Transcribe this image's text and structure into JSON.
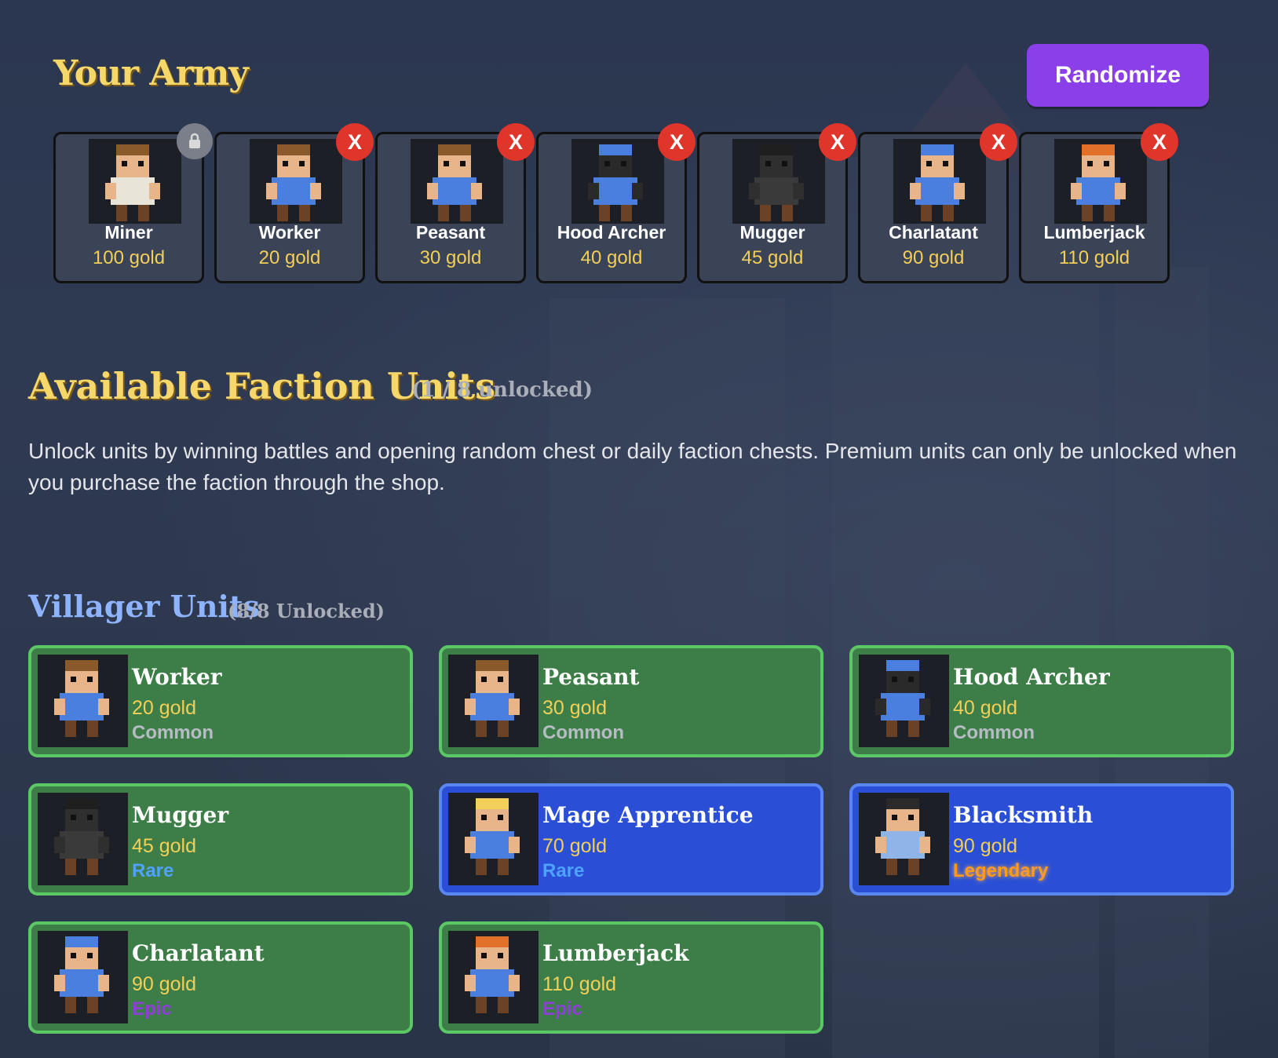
{
  "army": {
    "title": "Your Army",
    "randomize_label": "Randomize",
    "lock_icon": "lock-icon",
    "remove_label": "X",
    "units": [
      {
        "name": "Miner",
        "gold": "100 gold",
        "locked": true,
        "colors": {
          "skin": "#e8b48a",
          "shirt": "#e9e4d8",
          "hair": "#8a5a2b"
        }
      },
      {
        "name": "Worker",
        "gold": "20 gold",
        "locked": false,
        "colors": {
          "skin": "#e8b48a",
          "shirt": "#4a7fe0",
          "hair": "#8a5a2b"
        }
      },
      {
        "name": "Peasant",
        "gold": "30 gold",
        "locked": false,
        "colors": {
          "skin": "#e8b48a",
          "shirt": "#4a7fe0",
          "hair": "#8a5a2b"
        }
      },
      {
        "name": "Hood Archer",
        "gold": "40 gold",
        "locked": false,
        "colors": {
          "skin": "#2a2a2a",
          "shirt": "#4a7fe0",
          "hair": "#4a7fe0"
        }
      },
      {
        "name": "Mugger",
        "gold": "45 gold",
        "locked": false,
        "colors": {
          "skin": "#2f2f2f",
          "shirt": "#3a3a3a",
          "hair": "#1f1f1f"
        }
      },
      {
        "name": "Charlatant",
        "gold": "90 gold",
        "locked": false,
        "colors": {
          "skin": "#e8b48a",
          "shirt": "#4a7fe0",
          "hair": "#4a7fe0"
        }
      },
      {
        "name": "Lumberjack",
        "gold": "110 gold",
        "locked": false,
        "colors": {
          "skin": "#e8b48a",
          "shirt": "#4a7fe0",
          "hair": "#e0702a"
        }
      }
    ]
  },
  "available": {
    "title": "Available Faction Units",
    "count": "(1 / 8 unlocked)",
    "description": "Unlock units by winning battles and opening random chest or daily faction chests. Premium units can only be unlocked when you purchase the faction through the shop."
  },
  "villager": {
    "title": "Villager Units",
    "count": "(8/8 Unlocked)",
    "units": [
      {
        "name": "Worker",
        "gold": "20 gold",
        "rarity": "Common",
        "style": "green",
        "colors": {
          "skin": "#e8b48a",
          "shirt": "#4a7fe0",
          "hair": "#8a5a2b"
        }
      },
      {
        "name": "Peasant",
        "gold": "30 gold",
        "rarity": "Common",
        "style": "green",
        "colors": {
          "skin": "#e8b48a",
          "shirt": "#4a7fe0",
          "hair": "#8a5a2b"
        }
      },
      {
        "name": "Hood Archer",
        "gold": "40 gold",
        "rarity": "Common",
        "style": "green",
        "colors": {
          "skin": "#2a2a2a",
          "shirt": "#4a7fe0",
          "hair": "#4a7fe0"
        }
      },
      {
        "name": "Mugger",
        "gold": "45 gold",
        "rarity": "Rare",
        "style": "green",
        "colors": {
          "skin": "#2f2f2f",
          "shirt": "#3a3a3a",
          "hair": "#1f1f1f"
        }
      },
      {
        "name": "Mage Apprentice",
        "gold": "70 gold",
        "rarity": "Rare",
        "style": "blue",
        "colors": {
          "skin": "#e8b48a",
          "shirt": "#4a7fe0",
          "hair": "#f3d05a"
        }
      },
      {
        "name": "Blacksmith",
        "gold": "90 gold",
        "rarity": "Legendary",
        "style": "blue",
        "colors": {
          "skin": "#e8b48a",
          "shirt": "#8fb4e8",
          "hair": "#2a2a2a"
        }
      },
      {
        "name": "Charlatant",
        "gold": "90 gold",
        "rarity": "Epic",
        "style": "green",
        "colors": {
          "skin": "#e8b48a",
          "shirt": "#4a7fe0",
          "hair": "#4a7fe0"
        }
      },
      {
        "name": "Lumberjack",
        "gold": "110 gold",
        "rarity": "Epic",
        "style": "green",
        "colors": {
          "skin": "#e8b48a",
          "shirt": "#4a7fe0",
          "hair": "#e0702a"
        }
      }
    ]
  }
}
